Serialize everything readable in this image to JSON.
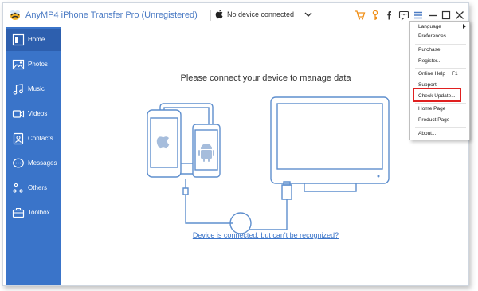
{
  "app": {
    "title": "AnyMP4 iPhone Transfer Pro (Unregistered)"
  },
  "device_selector": {
    "label": "No device connected"
  },
  "toolbar_icons": [
    "cart-icon",
    "key-icon",
    "facebook-icon",
    "feedback-icon",
    "menu-icon",
    "minimize-icon",
    "maximize-icon",
    "close-icon"
  ],
  "sidebar": {
    "items": [
      {
        "label": "Home",
        "icon": "home-icon",
        "active": true
      },
      {
        "label": "Photos",
        "icon": "photo-icon"
      },
      {
        "label": "Music",
        "icon": "music-icon"
      },
      {
        "label": "Videos",
        "icon": "video-icon"
      },
      {
        "label": "Contacts",
        "icon": "contacts-icon"
      },
      {
        "label": "Messages",
        "icon": "messages-icon"
      },
      {
        "label": "Others",
        "icon": "others-icon"
      },
      {
        "label": "Toolbox",
        "icon": "toolbox-icon"
      }
    ]
  },
  "main": {
    "title": "Please connect your device to manage data",
    "help_link": "Device is connected, but can't be recognized?"
  },
  "menu": {
    "items": [
      {
        "label": "Language",
        "submenu": true
      },
      {
        "label": "Preferences"
      },
      {
        "label": "Purchase"
      },
      {
        "label": "Register..."
      },
      {
        "label": "Online Help",
        "shortcut": "F1"
      },
      {
        "label": "Support"
      },
      {
        "label": "Check Update...",
        "highlighted": true
      },
      {
        "label": "Home Page"
      },
      {
        "label": "Product Page"
      },
      {
        "label": "About..."
      }
    ]
  },
  "colors": {
    "sidebar_bg": "#3a74c9",
    "sidebar_active": "#2d5fae",
    "accent": "#4b7bc4",
    "toolbar_orange": "#f0901a",
    "highlight_red": "#e02020"
  }
}
